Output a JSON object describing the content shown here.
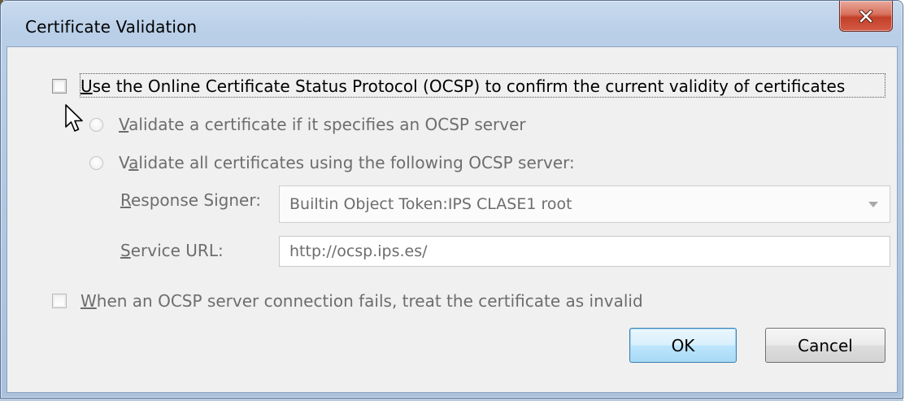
{
  "window": {
    "title": "Certificate Validation",
    "close_icon": "close-icon",
    "colors": {
      "frame": "#b9cfe8",
      "client": "#f0f0f0",
      "close_button": "#c2402a",
      "default_button_border": "#3c7fb1"
    }
  },
  "ocsp": {
    "use_checkbox": {
      "checked": false,
      "label": "Use the Online Certificate Status Protocol (OCSP) to confirm the current validity of certificates",
      "underlined_char": "U"
    },
    "radio_specified": {
      "selected": false,
      "enabled": false,
      "label": "Validate a certificate if it specifies an OCSP server",
      "underlined_char": "V"
    },
    "radio_all": {
      "selected": false,
      "enabled": false,
      "label": "Validate all certificates using the following OCSP server:",
      "underlined_char": "a"
    },
    "response_signer": {
      "label": "Response Signer:",
      "underlined_char": "R",
      "value": "Builtin Object Token:IPS CLASE1 root",
      "enabled": false
    },
    "service_url": {
      "label": "Service URL:",
      "underlined_char": "S",
      "value": "http://ocsp.ips.es/",
      "enabled": false
    },
    "fail_checkbox": {
      "checked": false,
      "enabled": false,
      "label": "When an OCSP server connection fails, treat the certificate as invalid",
      "underlined_char": "W"
    }
  },
  "buttons": {
    "ok": "OK",
    "cancel": "Cancel"
  }
}
